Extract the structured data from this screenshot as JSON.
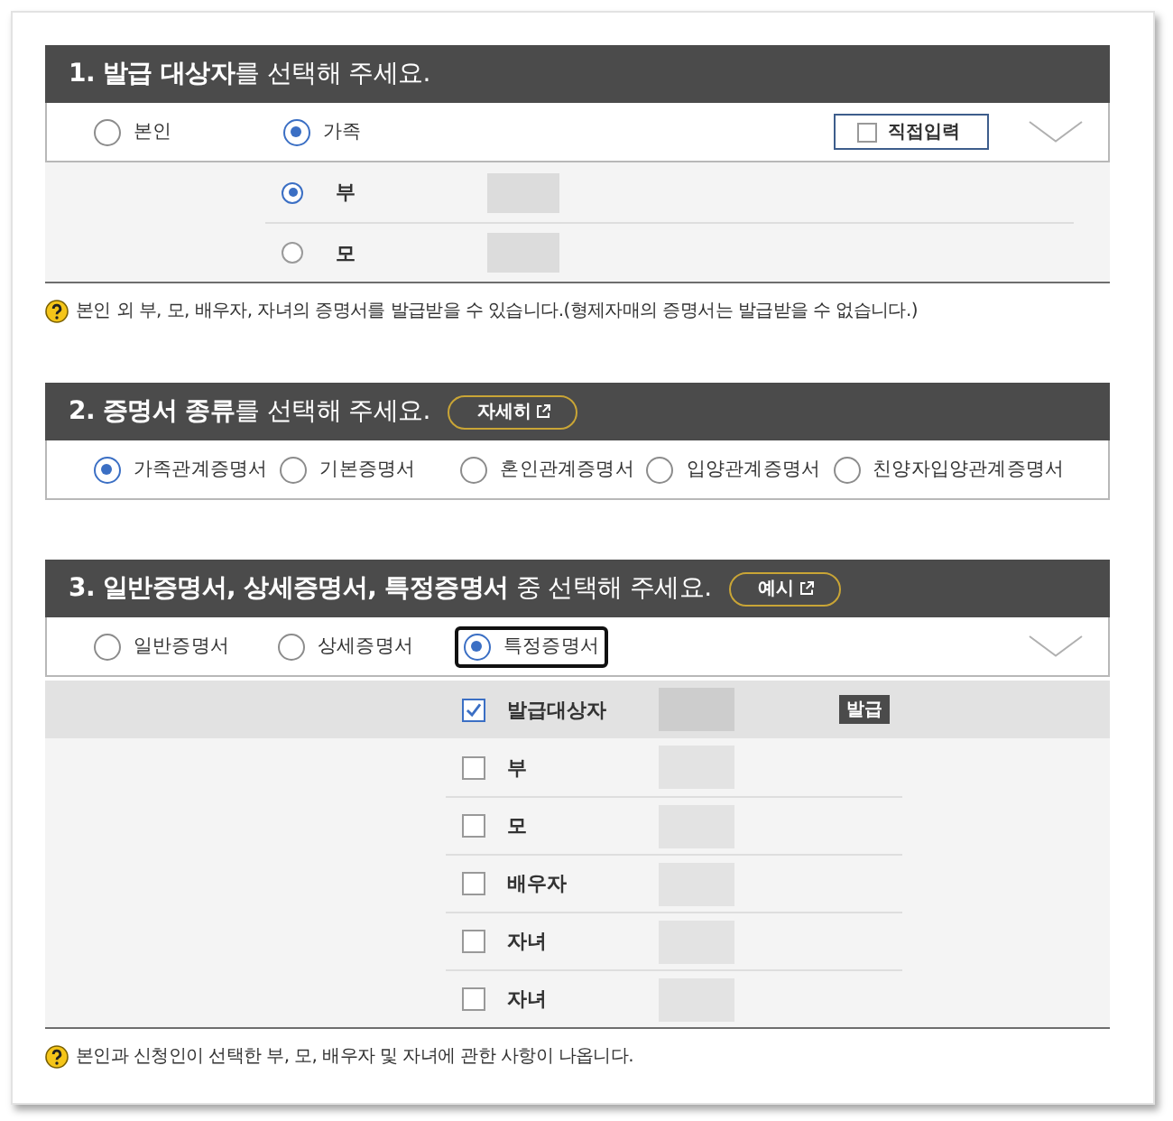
{
  "sections": [
    {
      "kind": "target",
      "title": "**1. 발급 대상자**를 선택해 주세요.",
      "collapsible": true,
      "options": [
        {
          "label": "본인",
          "selected": false
        },
        {
          "label": "가족",
          "selected": true
        }
      ],
      "direct_input": {
        "label": "직접입력",
        "checked": false
      },
      "members": [
        {
          "label": "부",
          "selected": true,
          "name_redacted": true
        },
        {
          "label": "모",
          "selected": false,
          "name_redacted": true
        }
      ],
      "note": "본인 외 부, 모, 배우자, 자녀의 증명서를 발급받을 수 있습니다.(형제자매의 증명서는 발급받을 수 없습니다.)"
    },
    {
      "kind": "type",
      "title": "**2. 증명서 종류**를 선택해 주세요.",
      "link_button": "자세히",
      "options": [
        {
          "label": "가족관계증명서",
          "selected": true
        },
        {
          "label": "기본증명서",
          "selected": false
        },
        {
          "label": "혼인관계증명서",
          "selected": false
        },
        {
          "label": "입양관계증명서",
          "selected": false
        },
        {
          "label": "친양자입양관계증명서",
          "selected": false
        }
      ]
    },
    {
      "kind": "detail",
      "title": "**3. 일반증명서, 상세증명서, 특정증명서** 중 선택해 주세요.",
      "link_button": "예시",
      "collapsible": true,
      "options": [
        {
          "label": "일반증명서",
          "selected": false,
          "focused": false
        },
        {
          "label": "상세증명서",
          "selected": false,
          "focused": false
        },
        {
          "label": "특정증명서",
          "selected": true,
          "focused": true
        }
      ],
      "members": [
        {
          "label": "발급대상자",
          "checked": true,
          "selected": true,
          "badge": "발급",
          "name_redacted": true
        },
        {
          "label": "부",
          "checked": false,
          "selected": false,
          "name_redacted": true
        },
        {
          "label": "모",
          "checked": false,
          "selected": false,
          "name_redacted": true
        },
        {
          "label": "배우자",
          "checked": false,
          "selected": false,
          "name_redacted": true
        },
        {
          "label": "자녀",
          "checked": false,
          "selected": false,
          "name_redacted": true
        },
        {
          "label": "자녀",
          "checked": false,
          "selected": false,
          "name_redacted": true
        }
      ],
      "note": "본인과 신청인이 선택한 부, 모, 배우자 및 자녀에 관한 사항이 나옵니다."
    }
  ]
}
